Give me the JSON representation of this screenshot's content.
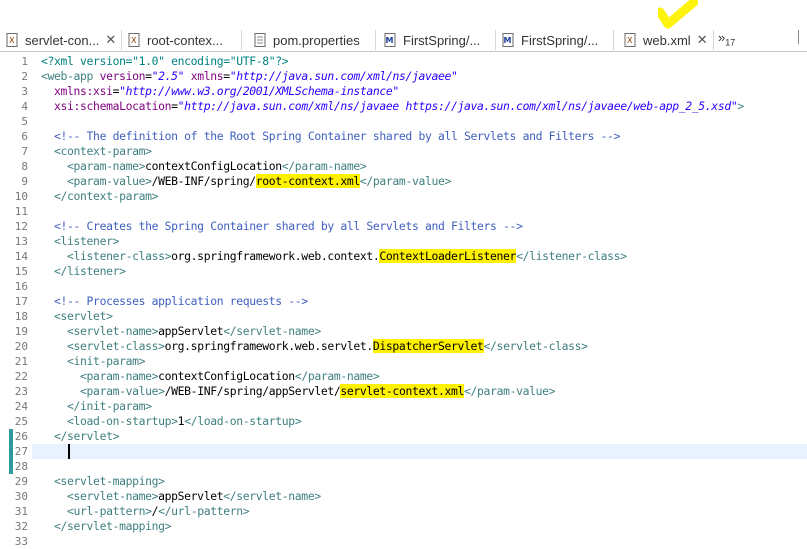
{
  "tabs": [
    {
      "label": "servlet-con...",
      "icon": "xml-file-icon",
      "closable": true,
      "active": false
    },
    {
      "label": "root-contex...",
      "icon": "xml-file-icon",
      "closable": false,
      "active": false
    },
    {
      "label": "pom.properties",
      "icon": "properties-file-icon",
      "closable": false,
      "active": false
    },
    {
      "label": "FirstSpring/...",
      "icon": "maven-pom-icon",
      "closable": false,
      "active": false
    },
    {
      "label": "FirstSpring/...",
      "icon": "maven-pom-icon",
      "closable": false,
      "active": false
    },
    {
      "label": "web.xml",
      "icon": "xml-file-icon",
      "closable": true,
      "active": true
    }
  ],
  "overflow": {
    "chevron": "»",
    "count": "17"
  },
  "highlight_color": "#fff200",
  "current_line": 27,
  "lines": [
    [
      {
        "t": "pi",
        "x": "<?xml version=\"1.0\" encoding=\"UTF-8\"?>"
      }
    ],
    [
      {
        "t": "tag",
        "x": "<web-app "
      },
      {
        "t": "an",
        "x": "version"
      },
      {
        "t": "tx",
        "x": "="
      },
      {
        "t": "av",
        "x": "\"2.5\""
      },
      {
        "t": "tx",
        "x": " "
      },
      {
        "t": "an",
        "x": "xmlns"
      },
      {
        "t": "tx",
        "x": "="
      },
      {
        "t": "av",
        "x": "\"http://java.sun.com/xml/ns/javaee\""
      }
    ],
    [
      {
        "t": "tx",
        "x": "  "
      },
      {
        "t": "an",
        "x": "xmlns:xsi"
      },
      {
        "t": "tx",
        "x": "="
      },
      {
        "t": "av",
        "x": "\"http://www.w3.org/2001/XMLSchema-instance\""
      }
    ],
    [
      {
        "t": "tx",
        "x": "  "
      },
      {
        "t": "an",
        "x": "xsi:schemaLocation"
      },
      {
        "t": "tx",
        "x": "="
      },
      {
        "t": "av",
        "x": "\"http://java.sun.com/xml/ns/javaee https://java.sun.com/xml/ns/javaee/web-app_2_5.xsd\""
      },
      {
        "t": "tag",
        "x": ">"
      }
    ],
    [],
    [
      {
        "t": "tx",
        "x": "  "
      },
      {
        "t": "c",
        "x": "<!-- The definition of the Root Spring Container shared by all Servlets and Filters -->"
      }
    ],
    [
      {
        "t": "tx",
        "x": "  "
      },
      {
        "t": "tag",
        "x": "<context-param>"
      }
    ],
    [
      {
        "t": "tx",
        "x": "    "
      },
      {
        "t": "tag",
        "x": "<param-name>"
      },
      {
        "t": "tx",
        "x": "contextConfigLocation"
      },
      {
        "t": "tag",
        "x": "</param-name>"
      }
    ],
    [
      {
        "t": "tx",
        "x": "    "
      },
      {
        "t": "tag",
        "x": "<param-value>"
      },
      {
        "t": "tx",
        "x": "/WEB-INF/spring/"
      },
      {
        "t": "tx",
        "x": "root-context.xml",
        "hl": true
      },
      {
        "t": "tag",
        "x": "</param-value>"
      }
    ],
    [
      {
        "t": "tx",
        "x": "  "
      },
      {
        "t": "tag",
        "x": "</context-param>"
      }
    ],
    [],
    [
      {
        "t": "tx",
        "x": "  "
      },
      {
        "t": "c",
        "x": "<!-- Creates the Spring Container shared by all Servlets and Filters -->"
      }
    ],
    [
      {
        "t": "tx",
        "x": "  "
      },
      {
        "t": "tag",
        "x": "<listener>"
      }
    ],
    [
      {
        "t": "tx",
        "x": "    "
      },
      {
        "t": "tag",
        "x": "<listener-class>"
      },
      {
        "t": "tx",
        "x": "org.springframework.web.context."
      },
      {
        "t": "tx",
        "x": "ContextLoaderListener",
        "hl": true
      },
      {
        "t": "tag",
        "x": "</listener-class>"
      }
    ],
    [
      {
        "t": "tx",
        "x": "  "
      },
      {
        "t": "tag",
        "x": "</listener>"
      }
    ],
    [],
    [
      {
        "t": "tx",
        "x": "  "
      },
      {
        "t": "c",
        "x": "<!-- Processes application requests -->"
      }
    ],
    [
      {
        "t": "tx",
        "x": "  "
      },
      {
        "t": "tag",
        "x": "<servlet>"
      }
    ],
    [
      {
        "t": "tx",
        "x": "    "
      },
      {
        "t": "tag",
        "x": "<servlet-name>"
      },
      {
        "t": "tx",
        "x": "appServlet"
      },
      {
        "t": "tag",
        "x": "</servlet-name>"
      }
    ],
    [
      {
        "t": "tx",
        "x": "    "
      },
      {
        "t": "tag",
        "x": "<servlet-class>"
      },
      {
        "t": "tx",
        "x": "org.springframework.web.servlet."
      },
      {
        "t": "tx",
        "x": "DispatcherServlet",
        "hl": true
      },
      {
        "t": "tag",
        "x": "</servlet-class>"
      }
    ],
    [
      {
        "t": "tx",
        "x": "    "
      },
      {
        "t": "tag",
        "x": "<init-param>"
      }
    ],
    [
      {
        "t": "tx",
        "x": "      "
      },
      {
        "t": "tag",
        "x": "<param-name>"
      },
      {
        "t": "tx",
        "x": "contextConfigLocation"
      },
      {
        "t": "tag",
        "x": "</param-name>"
      }
    ],
    [
      {
        "t": "tx",
        "x": "      "
      },
      {
        "t": "tag",
        "x": "<param-value>"
      },
      {
        "t": "tx",
        "x": "/WEB-INF/spring/appServlet/"
      },
      {
        "t": "tx",
        "x": "servlet-context.xml",
        "hl": true
      },
      {
        "t": "tag",
        "x": "</param-value>"
      }
    ],
    [
      {
        "t": "tx",
        "x": "    "
      },
      {
        "t": "tag",
        "x": "</init-param>"
      }
    ],
    [
      {
        "t": "tx",
        "x": "    "
      },
      {
        "t": "tag",
        "x": "<load-on-startup>"
      },
      {
        "t": "tx",
        "x": "1"
      },
      {
        "t": "tag",
        "x": "</load-on-startup>"
      }
    ],
    [
      {
        "t": "tx",
        "x": "  "
      },
      {
        "t": "tag",
        "x": "</servlet>"
      }
    ],
    [],
    [],
    [
      {
        "t": "tx",
        "x": "  "
      },
      {
        "t": "tag",
        "x": "<servlet-mapping>"
      }
    ],
    [
      {
        "t": "tx",
        "x": "    "
      },
      {
        "t": "tag",
        "x": "<servlet-name>"
      },
      {
        "t": "tx",
        "x": "appServlet"
      },
      {
        "t": "tag",
        "x": "</servlet-name>"
      }
    ],
    [
      {
        "t": "tx",
        "x": "    "
      },
      {
        "t": "tag",
        "x": "<url-pattern>"
      },
      {
        "t": "tx",
        "x": "/"
      },
      {
        "t": "tag",
        "x": "</url-pattern>"
      }
    ],
    [
      {
        "t": "tx",
        "x": "  "
      },
      {
        "t": "tag",
        "x": "</servlet-mapping>"
      }
    ],
    []
  ],
  "quick_diff_lines": [
    26,
    27,
    28
  ]
}
